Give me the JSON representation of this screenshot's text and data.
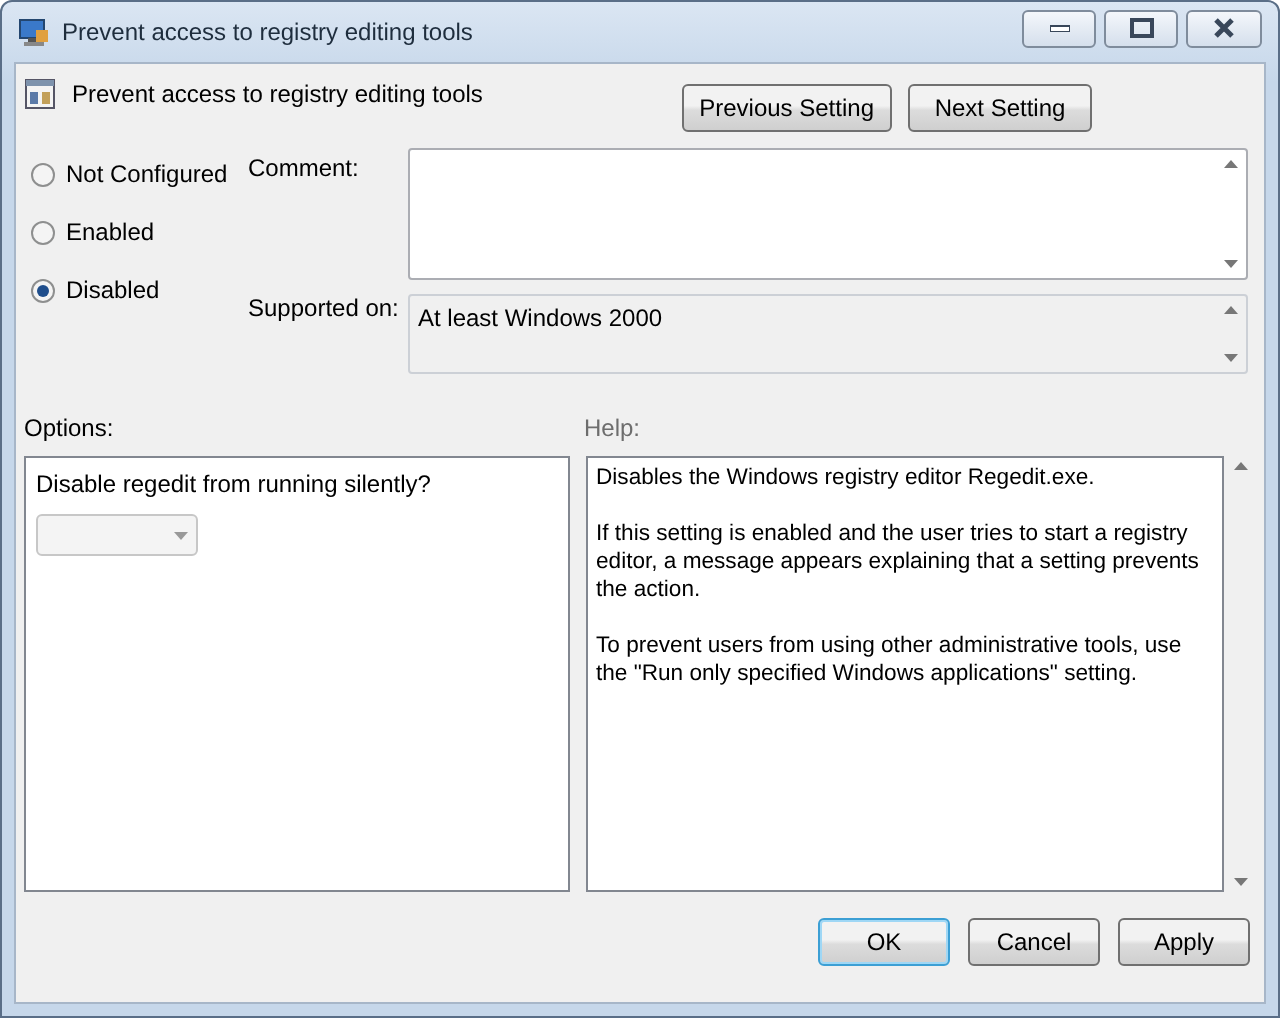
{
  "window": {
    "title": "Prevent access to registry editing tools"
  },
  "policy": {
    "title": "Prevent access to registry editing tools"
  },
  "nav_buttons": [
    "Previous Setting",
    "Next Setting"
  ],
  "state_options": [
    {
      "label": "Not Configured",
      "selected": false
    },
    {
      "label": "Enabled",
      "selected": false
    },
    {
      "label": "Disabled",
      "selected": true
    }
  ],
  "comment": {
    "label": "Comment:"
  },
  "supported_on": {
    "label": "Supported on:",
    "value": "At least Windows 2000"
  },
  "options": {
    "label": "Options:",
    "prompt": "Disable regedit from running silently?",
    "dropdown": {
      "disabled": true
    }
  },
  "help": {
    "label": "Help:",
    "paragraphs": [
      "Disables the Windows registry editor Regedit.exe.",
      "If this setting is enabled and the user tries to start a registry editor, a message appears explaining that a setting prevents the action.",
      "To prevent users from using other administrative tools, use the \"Run only specified Windows applications\" setting."
    ]
  },
  "buttons": [
    {
      "label": "OK",
      "default": true
    },
    {
      "label": "Cancel",
      "default": false
    },
    {
      "label": "Apply",
      "default": false
    }
  ]
}
